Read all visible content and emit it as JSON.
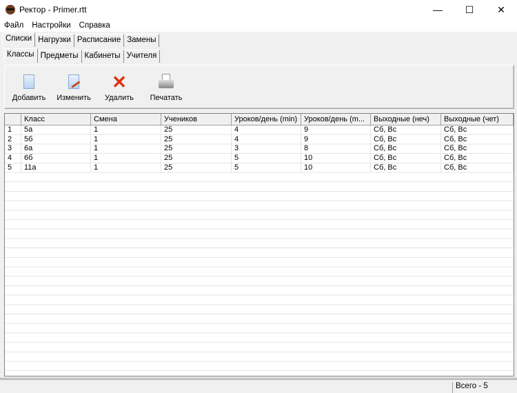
{
  "window": {
    "title": "Ректор - Primer.rtt",
    "minimize": "—",
    "maximize": "☐",
    "close": "✕"
  },
  "menu": [
    "Файл",
    "Настройки",
    "Справка"
  ],
  "main_tabs": [
    "Списки",
    "Нагрузки",
    "Расписание",
    "Замены"
  ],
  "sub_tabs": [
    "Классы",
    "Предметы",
    "Кабинеты",
    "Учителя"
  ],
  "toolbar": {
    "add": "Добавить",
    "edit": "Изменить",
    "delete": "Удалить",
    "print": "Печатать"
  },
  "table": {
    "columns": [
      "",
      "Класс",
      "Смена",
      "Учеников",
      "Уроков/день (min)",
      "Уроков/день (m...",
      "Выходные (неч)",
      "Выходные (чет)"
    ],
    "rows": [
      [
        "1",
        "5а",
        "1",
        "25",
        "4",
        "9",
        "Сб, Вс",
        "Сб, Вс"
      ],
      [
        "2",
        "5б",
        "1",
        "25",
        "4",
        "9",
        "Сб, Вс",
        "Сб, Вс"
      ],
      [
        "3",
        "6а",
        "1",
        "25",
        "3",
        "8",
        "Сб, Вс",
        "Сб, Вс"
      ],
      [
        "4",
        "6б",
        "1",
        "25",
        "5",
        "10",
        "Сб, Вс",
        "Сб, Вс"
      ],
      [
        "5",
        "11а",
        "1",
        "25",
        "5",
        "10",
        "Сб, Вс",
        "Сб, Вс"
      ]
    ]
  },
  "status": {
    "total": "Всего - 5"
  }
}
